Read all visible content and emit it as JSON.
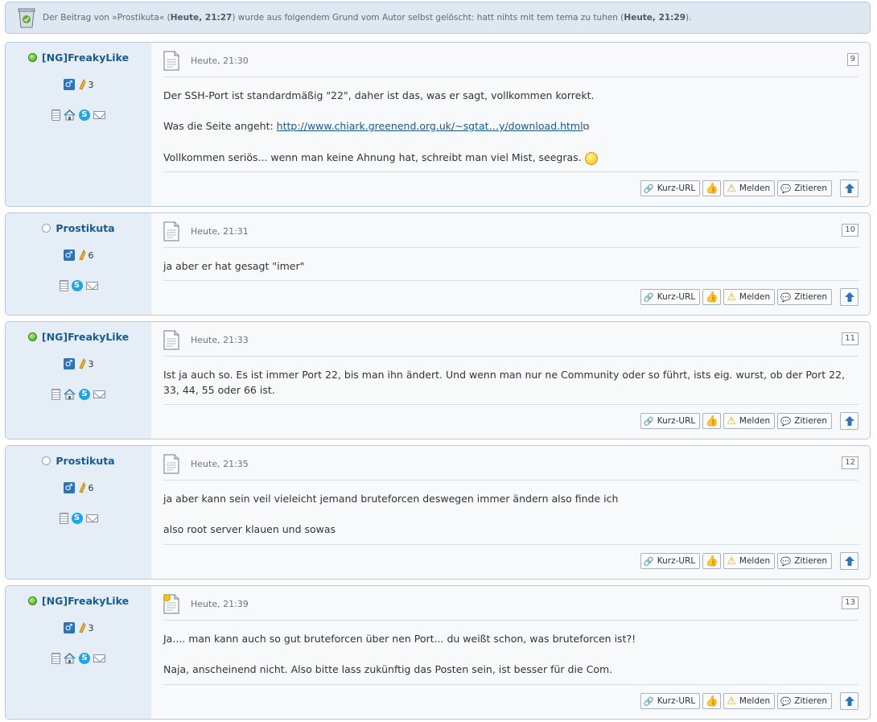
{
  "notice": {
    "prefix": "Der Beitrag von »",
    "author": "Prostikuta",
    "mid1": "« (",
    "time1": "Heute, 21:27",
    "mid2": ") wurde aus folgendem Grund vom Autor selbst gelöscht: hatt nihts mit tem tema zu tuhen (",
    "time2": "Heute, 21:29",
    "suffix": ")."
  },
  "buttons": {
    "shorturl": "Kurz-URL",
    "report": "Melden",
    "quote": "Zitieren"
  },
  "colors": {
    "sidebar": "#e5eef7",
    "border": "#b7c9de",
    "username": "#1b5a8c",
    "online": "#33a016"
  },
  "posts": [
    {
      "user": "[NG]FreakyLike",
      "online": true,
      "rep": "3",
      "has_home": true,
      "time": "Heute, 21:30",
      "number": "9",
      "p1": "Der SSH-Port ist standardmäßig \"22\", daher ist das, was er sagt, vollkommen korrekt.",
      "p2_prefix": "Was die Seite angeht: ",
      "p2_link": "http://www.chiark.greenend.org.uk/~sgtat…y/download.html",
      "p3": "Vollkommen seriös... wenn man keine Ahnung hat, schreibt man viel Mist, seegras."
    },
    {
      "user": "Prostikuta",
      "online": false,
      "rep": "6",
      "has_home": false,
      "time": "Heute, 21:31",
      "number": "10",
      "p1": "ja aber er hat gesagt \"imer\""
    },
    {
      "user": "[NG]FreakyLike",
      "online": true,
      "rep": "3",
      "has_home": true,
      "time": "Heute, 21:33",
      "number": "11",
      "p1": "Ist ja auch so. Es ist immer Port 22, bis man ihn ändert. Und wenn man nur ne Community oder so führt, ists eig. wurst, ob der Port 22, 33, 44, 55 oder 66 ist."
    },
    {
      "user": "Prostikuta",
      "online": false,
      "rep": "6",
      "has_home": false,
      "time": "Heute, 21:35",
      "number": "12",
      "p1": "ja aber kann sein veil vieleicht jemand bruteforcen deswegen immer ändern also finde ich",
      "p2": "also root server klauen und sowas"
    },
    {
      "user": "[NG]FreakyLike",
      "online": true,
      "rep": "3",
      "has_home": true,
      "time": "Heute, 21:39",
      "number": "13",
      "new": true,
      "p1": "Ja.... man kann auch so gut bruteforcen über nen Port... du weißt schon, was bruteforcen ist?!",
      "p2": "Naja, anscheinend nicht. Also bitte lass zukünftig das Posten sein, ist besser für die Com."
    }
  ]
}
